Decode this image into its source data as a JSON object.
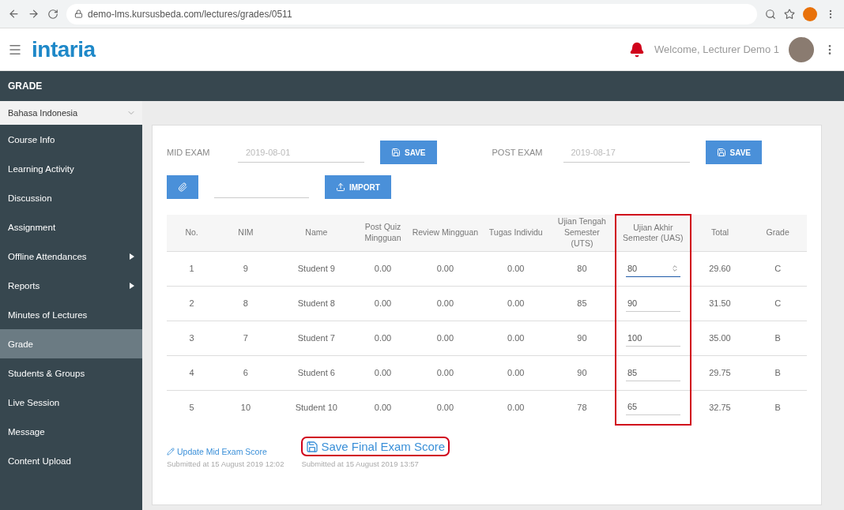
{
  "browser": {
    "url": "demo-lms.kursusbeda.com/lectures/grades/0511"
  },
  "header": {
    "logo": "intaria",
    "welcome": "Welcome, Lecturer Demo 1"
  },
  "page_title": "GRADE",
  "sidebar": {
    "language": "Bahasa Indonesia",
    "items": [
      {
        "label": "Course Info",
        "selected": false,
        "submenu": false
      },
      {
        "label": "Learning Activity",
        "selected": false,
        "submenu": false
      },
      {
        "label": "Discussion",
        "selected": false,
        "submenu": false
      },
      {
        "label": "Assignment",
        "selected": false,
        "submenu": false
      },
      {
        "label": "Offline Attendances",
        "selected": false,
        "submenu": true
      },
      {
        "label": "Reports",
        "selected": false,
        "submenu": true
      },
      {
        "label": "Minutes of Lectures",
        "selected": false,
        "submenu": false
      },
      {
        "label": "Grade",
        "selected": true,
        "submenu": false
      },
      {
        "label": "Students & Groups",
        "selected": false,
        "submenu": false
      },
      {
        "label": "Live Session",
        "selected": false,
        "submenu": false
      },
      {
        "label": "Message",
        "selected": false,
        "submenu": false
      },
      {
        "label": "Content Upload",
        "selected": false,
        "submenu": false
      }
    ]
  },
  "exam_dates": [
    {
      "label": "MID EXAM",
      "value": "2019-08-01",
      "button": "SAVE"
    },
    {
      "label": "POST EXAM",
      "value": "2019-08-17",
      "button": "SAVE"
    }
  ],
  "import": {
    "button": "IMPORT"
  },
  "table": {
    "columns": [
      {
        "label": "No.",
        "highlighted": false
      },
      {
        "label": "NIM",
        "highlighted": false
      },
      {
        "label": "Name",
        "highlighted": false
      },
      {
        "label": "Post Quiz Mingguan",
        "highlighted": false
      },
      {
        "label": "Review Mingguan",
        "highlighted": false
      },
      {
        "label": "Tugas Individu",
        "highlighted": false
      },
      {
        "label": "Ujian Tengah Semester (UTS)",
        "highlighted": false
      },
      {
        "label": "Ujian Akhir Semester (UAS)",
        "highlighted": true
      },
      {
        "label": "Total",
        "highlighted": false
      },
      {
        "label": "Grade",
        "highlighted": false
      }
    ],
    "rows": [
      {
        "cells": [
          "1",
          "9",
          "Student 9",
          "0.00",
          "0.00",
          "0.00",
          "80"
        ],
        "uas": "80",
        "focused": true,
        "total": "29.60",
        "grade": "C"
      },
      {
        "cells": [
          "2",
          "8",
          "Student 8",
          "0.00",
          "0.00",
          "0.00",
          "85"
        ],
        "uas": "90",
        "focused": false,
        "total": "31.50",
        "grade": "C"
      },
      {
        "cells": [
          "3",
          "7",
          "Student 7",
          "0.00",
          "0.00",
          "0.00",
          "90"
        ],
        "uas": "100",
        "focused": false,
        "total": "35.00",
        "grade": "B"
      },
      {
        "cells": [
          "4",
          "6",
          "Student 6",
          "0.00",
          "0.00",
          "0.00",
          "90"
        ],
        "uas": "85",
        "focused": false,
        "total": "29.75",
        "grade": "B"
      },
      {
        "cells": [
          "5",
          "10",
          "Student 10",
          "0.00",
          "0.00",
          "0.00",
          "78"
        ],
        "uas": "65",
        "focused": false,
        "total": "32.75",
        "grade": "B"
      }
    ]
  },
  "footer": [
    {
      "link": "Update Mid Exam Score",
      "submitted": "Submitted at 15 August 2019 12:02",
      "highlighted": false
    },
    {
      "link": "Save Final Exam Score",
      "submitted": "Submitted at 15 August 2019 13:57",
      "highlighted": true
    }
  ]
}
